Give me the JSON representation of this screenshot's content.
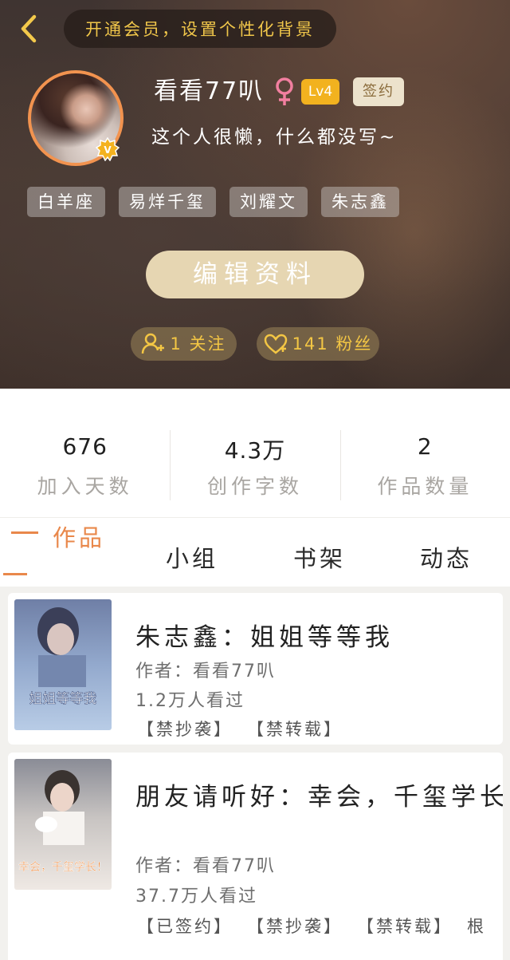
{
  "header": {
    "vip_banner": "开通会员，设置个性化背景",
    "username": "看看77叭",
    "level": "Lv4",
    "sign_badge": "签约",
    "bio": "这个人很懒，什么都没写~",
    "tags": [
      "白羊座",
      "易烊千玺",
      "刘耀文",
      "朱志鑫"
    ],
    "edit_button": "编辑资料",
    "follow_label": "1 关注",
    "fans_label": "141 粉丝"
  },
  "stats": [
    {
      "value": "676",
      "label": "加入天数"
    },
    {
      "value": "4.3万",
      "label": "创作字数"
    },
    {
      "value": "2",
      "label": "作品数量"
    }
  ],
  "tabs": [
    {
      "label": "作品",
      "active": true
    },
    {
      "label": "小组",
      "active": false
    },
    {
      "label": "书架",
      "active": false
    },
    {
      "label": "动态",
      "active": false
    }
  ],
  "works": [
    {
      "title": "朱志鑫：姐姐等等我",
      "author": "作者：看看77叭",
      "views": "1.2万人看过",
      "tags": [
        "【禁抄袭】",
        "【禁转载】"
      ],
      "cover_text": "姐姐等等我"
    },
    {
      "title": "朋友请听好：幸会，千玺学长",
      "author": "作者：看看77叭",
      "views": "37.7万人看过",
      "tags": [
        "【已签约】",
        "【禁抄袭】",
        "【禁转载】",
        "根"
      ],
      "cover_text": "幸会，千玺学长！"
    }
  ],
  "colors": {
    "accent": "#e9884b",
    "gold": "#f0c64a",
    "level_badge": "#f2b21f",
    "gender": "#f27fa0"
  },
  "icons": {
    "back": "chevron-left-icon",
    "gender": "female-icon",
    "verified": "v-badge-icon",
    "follow": "add-user-icon",
    "fans": "heart-icon"
  }
}
